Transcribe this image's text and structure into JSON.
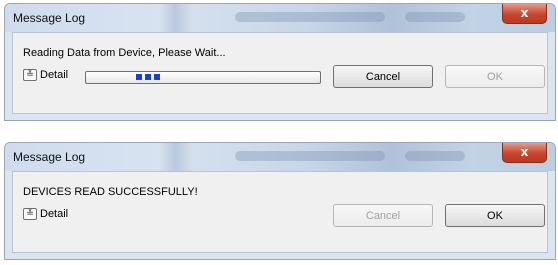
{
  "dialogs": [
    {
      "title": "Message Log",
      "close_symbol": "x",
      "message": "Reading Data from Device, Please Wait...",
      "detail_label": "Detail",
      "detail_icon": "chevron-double-down-icon",
      "progress_fraction": 0.3,
      "buttons": {
        "cancel": "Cancel",
        "ok": "OK"
      },
      "button_state": {
        "cancel": "enabled",
        "ok": "disabled"
      }
    },
    {
      "title": "Message Log",
      "close_symbol": "x",
      "message": "DEVICES READ SUCCESSFULLY!",
      "detail_label": "Detail",
      "detail_icon": "chevron-double-down-icon",
      "buttons": {
        "cancel": "Cancel",
        "ok": "OK"
      },
      "button_state": {
        "cancel": "disabled",
        "ok": "enabled"
      }
    }
  ],
  "colors": {
    "close_button": "#c7452d",
    "progress_fill": "#1a3fd6",
    "title_bar": "#cfdced",
    "client_area": "#f0f0f0"
  }
}
